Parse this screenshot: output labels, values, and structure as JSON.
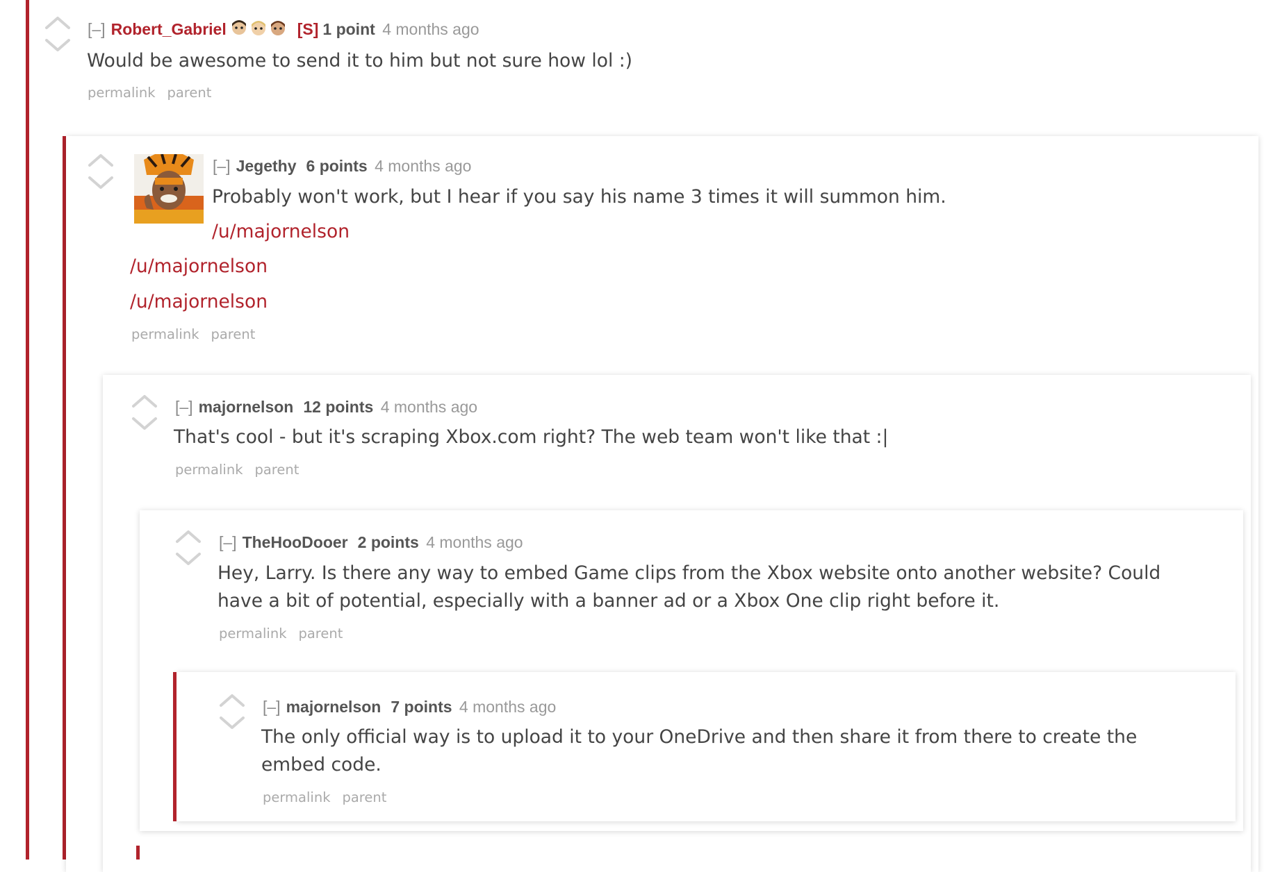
{
  "comments": [
    {
      "author": "Robert_Gabriel",
      "submitter_tag": "[S]",
      "score": "1 point",
      "time": "4 months ago",
      "expand": "[–]",
      "body": "Would be awesome to send it to him but not sure how lol :)",
      "buttons": {
        "permalink": "permalink",
        "parent": "parent"
      }
    },
    {
      "author": "Jegethy",
      "score": "6 points",
      "time": "4 months ago",
      "expand": "[–]",
      "body": "Probably won't work, but I hear if you say his name 3 times it will summon him.",
      "links": [
        "/u/majornelson",
        "/u/majornelson",
        "/u/majornelson"
      ],
      "buttons": {
        "permalink": "permalink",
        "parent": "parent"
      }
    },
    {
      "author": "majornelson",
      "score": "12 points",
      "time": "4 months ago",
      "expand": "[–]",
      "body": "That's cool - but it's scraping Xbox.com right? The web team won't like that :|",
      "buttons": {
        "permalink": "permalink",
        "parent": "parent"
      }
    },
    {
      "author": "TheHooDooer",
      "score": "2 points",
      "time": "4 months ago",
      "expand": "[–]",
      "body_lines": [
        "Hey, Larry. Is there any way to embed Game clips from the Xbox website onto another website? Could",
        "have a bit of potential, especially with a banner ad or a Xbox One clip right before it."
      ],
      "buttons": {
        "permalink": "permalink",
        "parent": "parent"
      }
    },
    {
      "author": "majornelson",
      "score": "7 points",
      "time": "4 months ago",
      "expand": "[–]",
      "body_lines": [
        "The only official way is to upload it to your OneDrive and then share it from there to create the",
        "embed code."
      ],
      "buttons": {
        "permalink": "permalink",
        "parent": "parent"
      }
    }
  ],
  "colors": {
    "thread_bar": "#b1232c",
    "link": "#b1232c",
    "author": "#555555",
    "meta": "#999999",
    "buttons": "#aaaaaa",
    "body": "#444444"
  },
  "icons": [
    "upvote-arrow-icon",
    "downvote-arrow-icon",
    "flair-icon",
    "user-avatar"
  ]
}
